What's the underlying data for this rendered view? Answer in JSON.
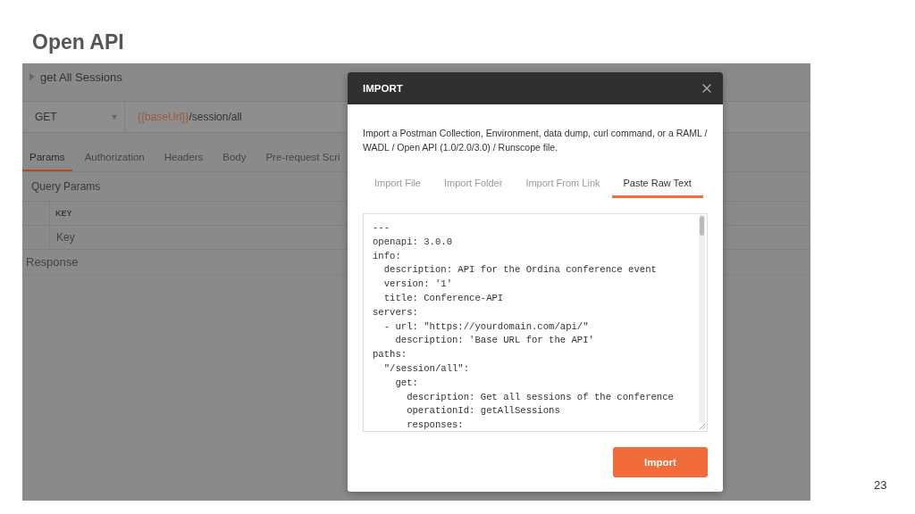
{
  "slide": {
    "title": "Open API",
    "page_number": "23"
  },
  "request": {
    "name": "get All Sessions",
    "expanded": false,
    "method": "GET",
    "url_variable": "{{baseUrl}}",
    "url_path": "/session/all",
    "tabs": [
      {
        "label": "Params",
        "selected": true
      },
      {
        "label": "Authorization",
        "selected": false
      },
      {
        "label": "Headers",
        "selected": false
      },
      {
        "label": "Body",
        "selected": false
      },
      {
        "label": "Pre-request Scri",
        "selected": false
      }
    ],
    "query_params": {
      "title": "Query Params",
      "columns": [
        "KEY"
      ],
      "placeholder": "Key"
    },
    "response_title": "Response"
  },
  "dialog": {
    "title": "IMPORT",
    "description": "Import a Postman Collection, Environment, data dump, curl command, or a RAML / WADL / Open API (1.0/2.0/3.0) / Runscope file.",
    "tabs": [
      {
        "label": "Import File",
        "selected": false
      },
      {
        "label": "Import Folder",
        "selected": false
      },
      {
        "label": "Import From Link",
        "selected": false
      },
      {
        "label": "Paste Raw Text",
        "selected": true
      }
    ],
    "code_lines": [
      "---",
      "openapi: 3.0.0",
      "info:",
      "  description: API for the Ordina conference event",
      "  version: '1'",
      "  title: Conference-API",
      "servers:",
      "  - url: \"https://yourdomain.com/api/\"",
      "    description: 'Base URL for the API'",
      "paths:",
      "  \"/session/all\":",
      "    get:",
      "      description: Get all sessions of the conference",
      "      operationId: getAllSessions",
      "      responses:"
    ],
    "button": "Import"
  }
}
